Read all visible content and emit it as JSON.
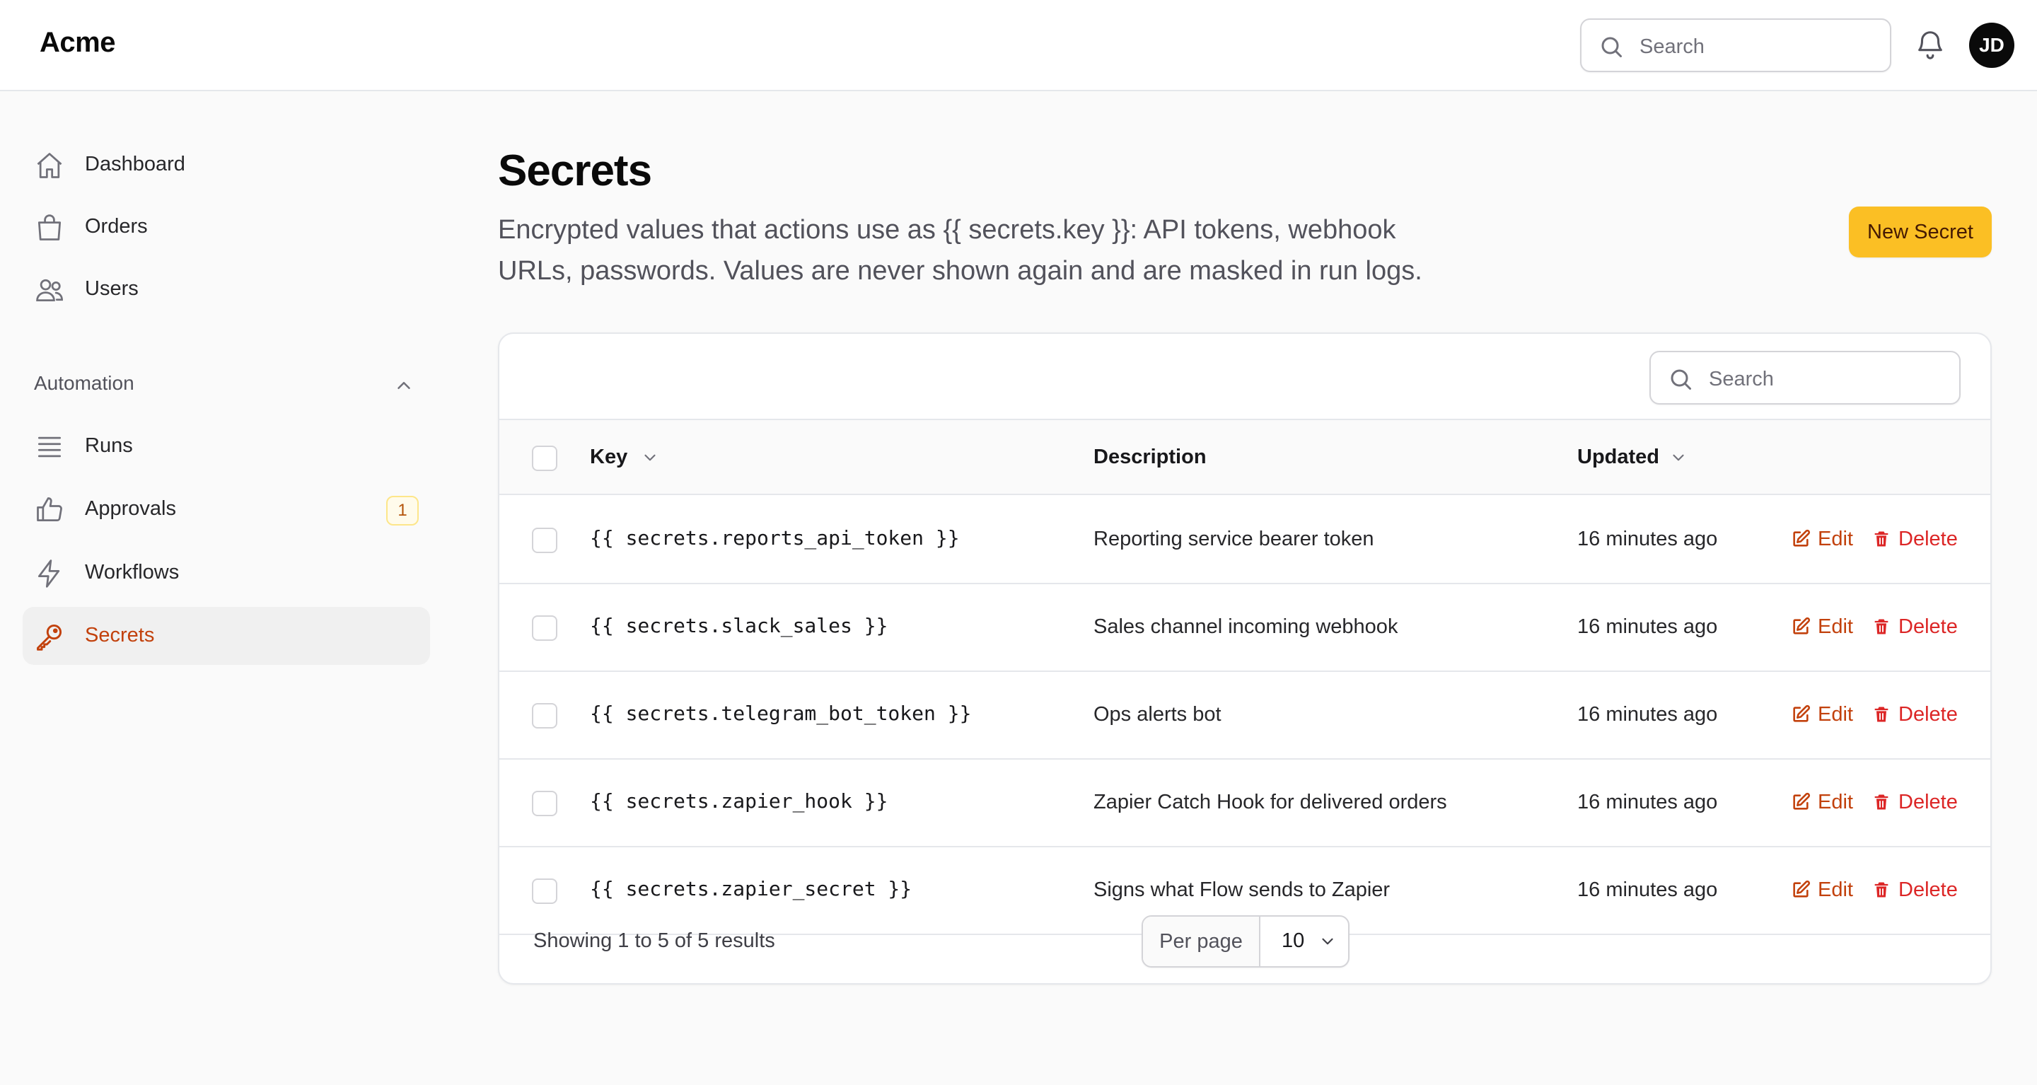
{
  "app": {
    "brand": "Acme"
  },
  "header": {
    "search_placeholder": "Search",
    "avatar_initials": "JD"
  },
  "sidebar": {
    "items": [
      {
        "label": "Dashboard",
        "icon": "home-icon"
      },
      {
        "label": "Orders",
        "icon": "shopping-bag-icon"
      },
      {
        "label": "Users",
        "icon": "users-icon"
      }
    ],
    "group": {
      "label": "Automation",
      "items": [
        {
          "label": "Runs",
          "icon": "list-icon"
        },
        {
          "label": "Approvals",
          "icon": "thumbs-up-icon",
          "badge": "1"
        },
        {
          "label": "Workflows",
          "icon": "bolt-icon"
        },
        {
          "label": "Secrets",
          "icon": "key-icon",
          "active": true
        }
      ]
    }
  },
  "page": {
    "title": "Secrets",
    "description": "Encrypted values that actions use as {{ secrets.key }}: API tokens, webhook URLs, passwords. Values are never shown again and are masked in run logs.",
    "new_button": "New Secret"
  },
  "table": {
    "search_placeholder": "Search",
    "columns": {
      "key": "Key",
      "description": "Description",
      "updated": "Updated"
    },
    "actions": {
      "edit": "Edit",
      "delete": "Delete"
    },
    "rows": [
      {
        "key": "{{ secrets.reports_api_token }}",
        "description": "Reporting service bearer token",
        "updated": "16 minutes ago"
      },
      {
        "key": "{{ secrets.slack_sales }}",
        "description": "Sales channel incoming webhook",
        "updated": "16 minutes ago"
      },
      {
        "key": "{{ secrets.telegram_bot_token }}",
        "description": "Ops alerts bot",
        "updated": "16 minutes ago"
      },
      {
        "key": "{{ secrets.zapier_hook }}",
        "description": "Zapier Catch Hook for delivered orders",
        "updated": "16 minutes ago"
      },
      {
        "key": "{{ secrets.zapier_secret }}",
        "description": "Signs what Flow sends to Zapier",
        "updated": "16 minutes ago"
      }
    ],
    "footer": {
      "summary": "Showing 1 to 5 of 5 results",
      "per_page_label": "Per page",
      "per_page_value": "10"
    }
  },
  "colors": {
    "accent": "#c2410c",
    "primary_button": "#fbbf24",
    "danger": "#dc2626"
  }
}
